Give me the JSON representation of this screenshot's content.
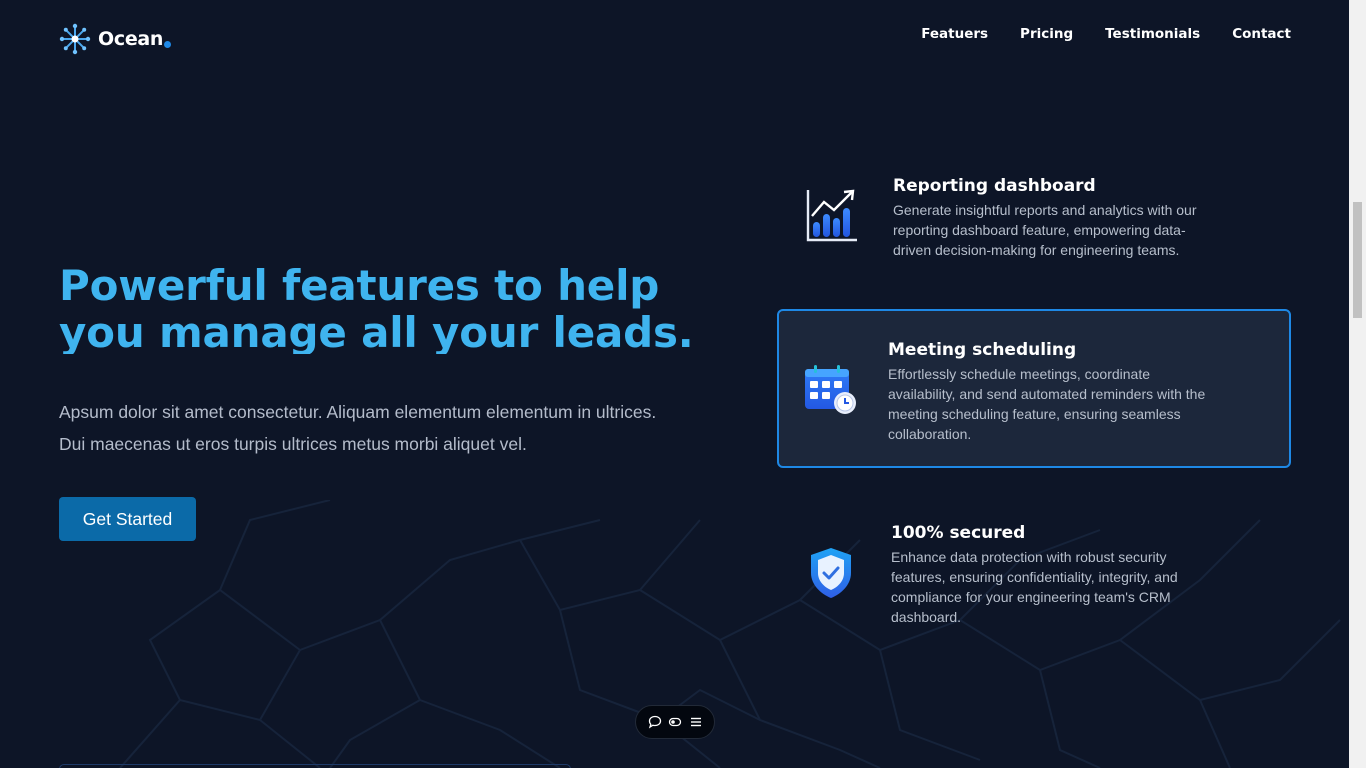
{
  "header": {
    "logo_text": "Ocean",
    "nav": [
      "Featuers",
      "Pricing",
      "Testimonials",
      "Contact"
    ]
  },
  "hero": {
    "title_line1": "Powerful features to help",
    "title_line2": "you manage all your leads.",
    "subtitle_line1": "Apsum dolor sit amet consectetur. Aliquam elementum elementum in ultrices.",
    "subtitle_line2": "Dui maecenas ut eros turpis ultrices metus morbi aliquet vel.",
    "cta_label": "Get Started"
  },
  "features": [
    {
      "title": "Reporting dashboard",
      "description": "Generate insightful reports and analytics with our reporting dashboard feature, empowering data-driven decision-making for engineering teams.",
      "icon": "chart-icon"
    },
    {
      "title": "Meeting scheduling",
      "description": "Effortlessly schedule meetings, coordinate availability, and send automated reminders with the meeting scheduling feature, ensuring seamless collaboration.",
      "icon": "calendar-icon"
    },
    {
      "title": "100% secured",
      "description": "Enhance data protection with robust security features, ensuring confidentiality, integrity, and compliance for your engineering team's CRM dashboard.",
      "icon": "shield-check-icon"
    }
  ],
  "colors": {
    "background": "#0d1527",
    "accent": "#3fb4ef",
    "button": "#0b6aa8",
    "active_border": "#1e88e5",
    "card_bg": "#1c273b"
  },
  "toolbar_icons": [
    "chat-icon",
    "toggle-icon",
    "menu-icon"
  ]
}
